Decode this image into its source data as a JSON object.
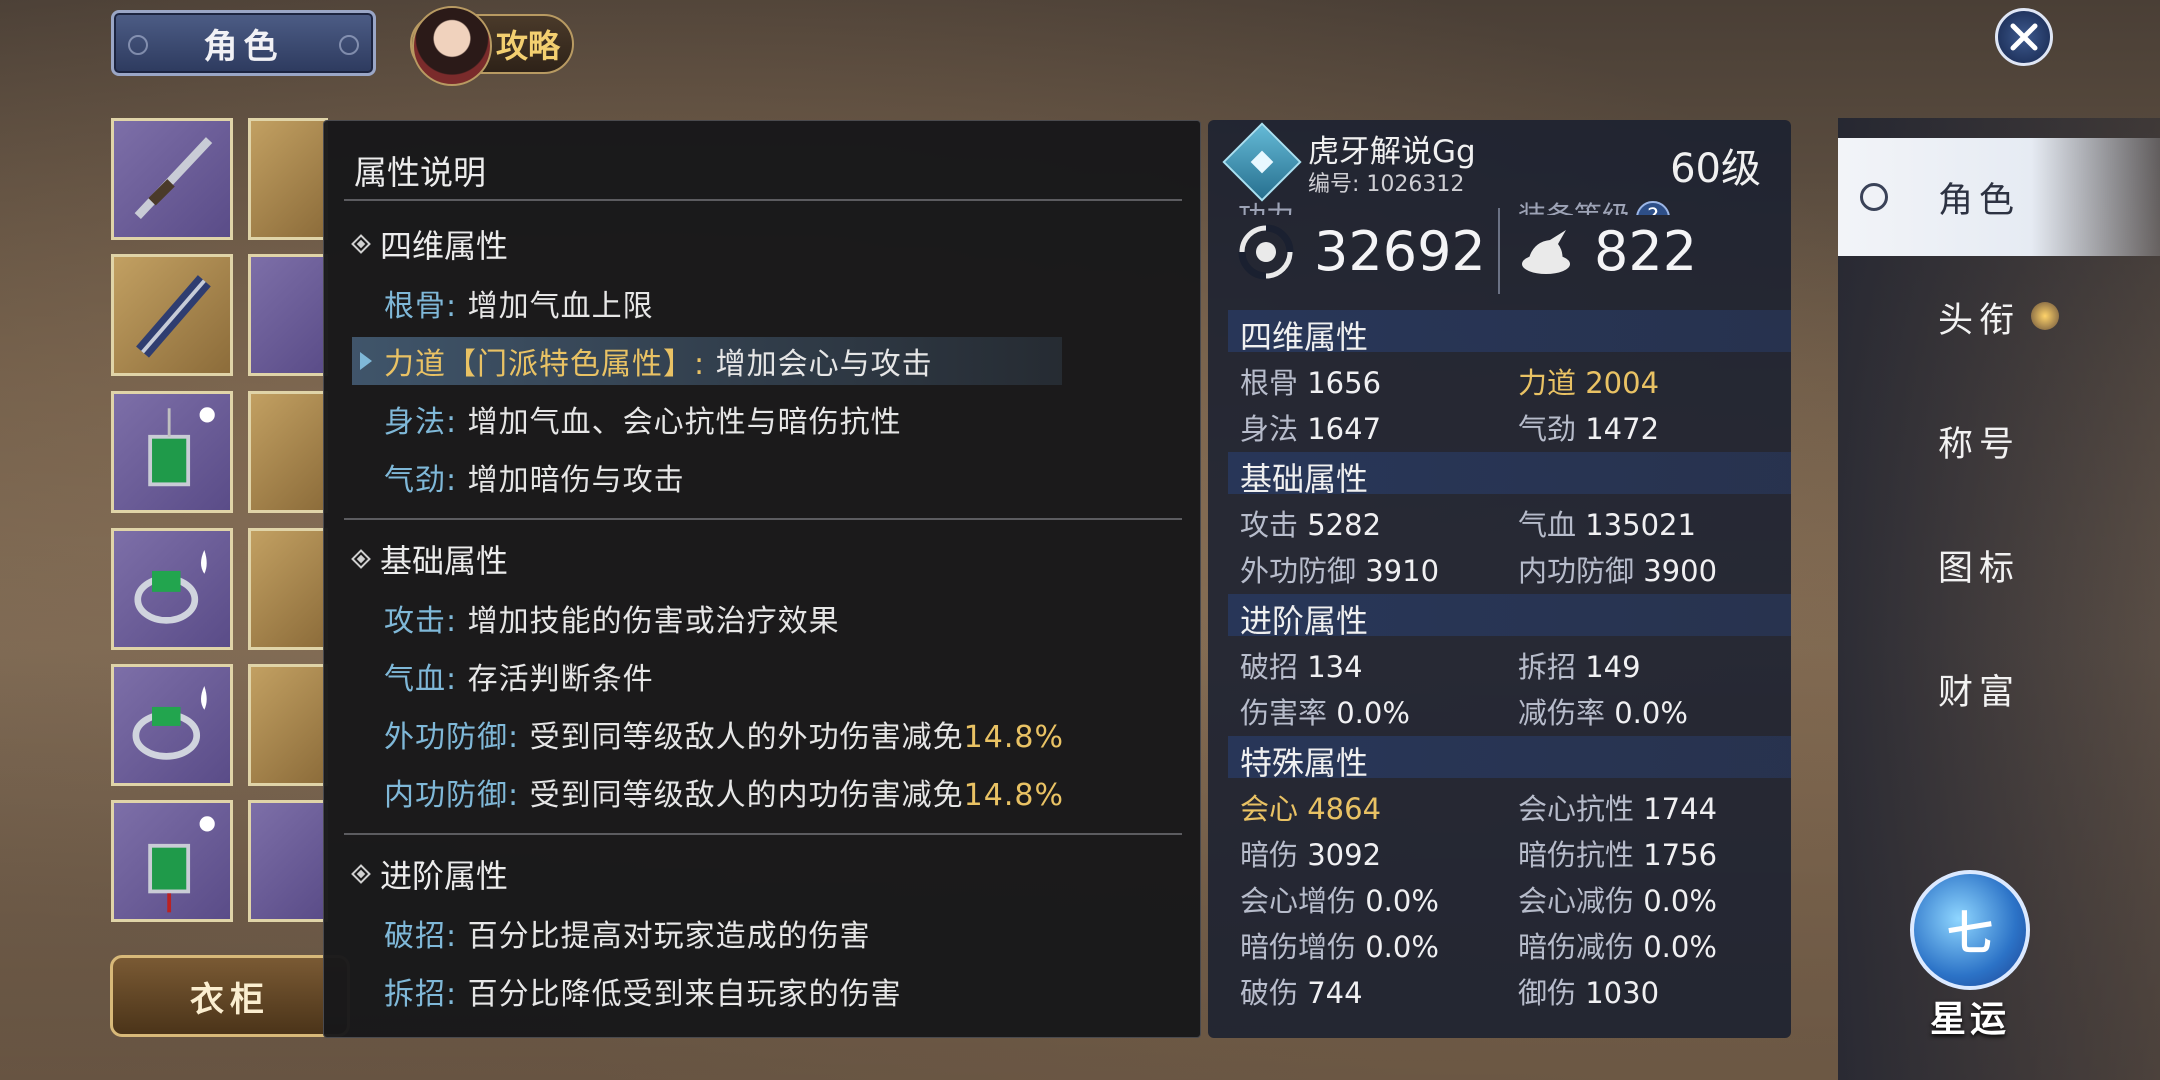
{
  "header": {
    "role_tab": "角色",
    "guide_tab": "攻略"
  },
  "wardrobe_label": "衣柜",
  "tooltip": {
    "title": "属性说明",
    "sections": [
      {
        "title": "四维属性",
        "rows": [
          {
            "key": "根骨",
            "text": "增加气血上限"
          },
          {
            "key": "力道【门派特色属性】",
            "text": "增加会心与攻击"
          },
          {
            "key": "身法",
            "text": "增加气血、会心抗性与暗伤抗性"
          },
          {
            "key": "气劲",
            "text": "增加暗伤与攻击"
          }
        ]
      },
      {
        "title": "基础属性",
        "rows": [
          {
            "key": "攻击",
            "text": "增加技能的伤害或治疗效果"
          },
          {
            "key": "气血",
            "text": "存活判断条件"
          },
          {
            "key": "外功防御",
            "text": "受到同等级敌人的外功伤害减免",
            "pct": "14.8%"
          },
          {
            "key": "内功防御",
            "text": "受到同等级敌人的内功伤害减免",
            "pct": "14.8%"
          }
        ]
      },
      {
        "title": "进阶属性",
        "rows": [
          {
            "key": "破招",
            "text": "百分比提高对玩家造成的伤害"
          },
          {
            "key": "拆招",
            "text": "百分比降低受到来自玩家的伤害"
          }
        ]
      }
    ]
  },
  "player": {
    "name": "虎牙解说Gg",
    "id_label": "编号: 1026312",
    "level": "60级",
    "power_label": "功力",
    "power": "32692",
    "equip_label": "装备等级",
    "equip_level": "822",
    "help_glyph": "?"
  },
  "stats": {
    "four_dim": {
      "title": "四维属性",
      "rows": [
        [
          {
            "label": "根骨",
            "value": "1656"
          },
          {
            "label": "力道",
            "value": "2004",
            "highlight": true
          }
        ],
        [
          {
            "label": "身法",
            "value": "1647"
          },
          {
            "label": "气劲",
            "value": "1472"
          }
        ]
      ]
    },
    "basic": {
      "title": "基础属性",
      "rows": [
        [
          {
            "label": "攻击",
            "value": "5282"
          },
          {
            "label": "气血",
            "value": "135021"
          }
        ],
        [
          {
            "label": "外功防御",
            "value": "3910"
          },
          {
            "label": "内功防御",
            "value": "3900"
          }
        ]
      ]
    },
    "advanced": {
      "title": "进阶属性",
      "rows": [
        [
          {
            "label": "破招",
            "value": "134"
          },
          {
            "label": "拆招",
            "value": "149"
          }
        ],
        [
          {
            "label": "伤害率",
            "value": "0.0%"
          },
          {
            "label": "减伤率",
            "value": "0.0%"
          }
        ]
      ]
    },
    "special": {
      "title": "特殊属性",
      "rows": [
        [
          {
            "label": "会心",
            "value": "4864",
            "highlight": true
          },
          {
            "label": "会心抗性",
            "value": "1744"
          }
        ],
        [
          {
            "label": "暗伤",
            "value": "3092"
          },
          {
            "label": "暗伤抗性",
            "value": "1756"
          }
        ],
        [
          {
            "label": "会心增伤",
            "value": "0.0%"
          },
          {
            "label": "会心减伤",
            "value": "0.0%"
          }
        ],
        [
          {
            "label": "暗伤增伤",
            "value": "0.0%"
          },
          {
            "label": "暗伤减伤",
            "value": "0.0%"
          }
        ],
        [
          {
            "label": "破伤",
            "value": "744"
          },
          {
            "label": "御伤",
            "value": "1030"
          }
        ]
      ]
    }
  },
  "sidenav": [
    "角色",
    "头衔",
    "称号",
    "图标",
    "财富"
  ],
  "fate": {
    "glyph": "七",
    "label": "星运"
  },
  "colors": {
    "accent_gold": "#e9c264",
    "accent_blue": "#7fb8d8",
    "panel_bg": "#1a2030"
  }
}
